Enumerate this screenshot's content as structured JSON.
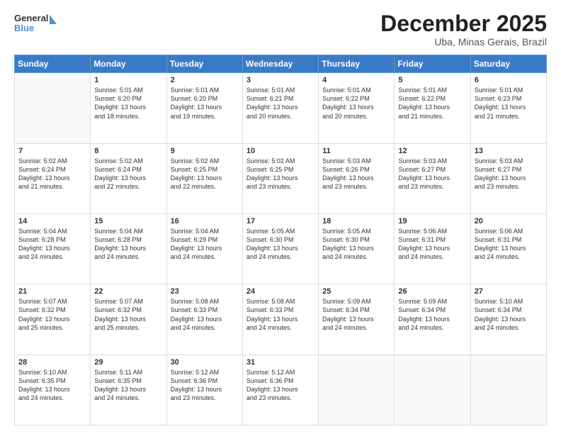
{
  "logo": {
    "line1": "General",
    "line2": "Blue"
  },
  "title": "December 2025",
  "subtitle": "Uba, Minas Gerais, Brazil",
  "days_of_week": [
    "Sunday",
    "Monday",
    "Tuesday",
    "Wednesday",
    "Thursday",
    "Friday",
    "Saturday"
  ],
  "weeks": [
    [
      {
        "day": "",
        "info": ""
      },
      {
        "day": "1",
        "info": "Sunrise: 5:01 AM\nSunset: 6:20 PM\nDaylight: 13 hours\nand 18 minutes."
      },
      {
        "day": "2",
        "info": "Sunrise: 5:01 AM\nSunset: 6:20 PM\nDaylight: 13 hours\nand 19 minutes."
      },
      {
        "day": "3",
        "info": "Sunrise: 5:01 AM\nSunset: 6:21 PM\nDaylight: 13 hours\nand 20 minutes."
      },
      {
        "day": "4",
        "info": "Sunrise: 5:01 AM\nSunset: 6:22 PM\nDaylight: 13 hours\nand 20 minutes."
      },
      {
        "day": "5",
        "info": "Sunrise: 5:01 AM\nSunset: 6:22 PM\nDaylight: 13 hours\nand 21 minutes."
      },
      {
        "day": "6",
        "info": "Sunrise: 5:01 AM\nSunset: 6:23 PM\nDaylight: 13 hours\nand 21 minutes."
      }
    ],
    [
      {
        "day": "7",
        "info": "Sunrise: 5:02 AM\nSunset: 6:24 PM\nDaylight: 13 hours\nand 21 minutes."
      },
      {
        "day": "8",
        "info": "Sunrise: 5:02 AM\nSunset: 6:24 PM\nDaylight: 13 hours\nand 22 minutes."
      },
      {
        "day": "9",
        "info": "Sunrise: 5:02 AM\nSunset: 6:25 PM\nDaylight: 13 hours\nand 22 minutes."
      },
      {
        "day": "10",
        "info": "Sunrise: 5:02 AM\nSunset: 6:25 PM\nDaylight: 13 hours\nand 23 minutes."
      },
      {
        "day": "11",
        "info": "Sunrise: 5:03 AM\nSunset: 6:26 PM\nDaylight: 13 hours\nand 23 minutes."
      },
      {
        "day": "12",
        "info": "Sunrise: 5:03 AM\nSunset: 6:27 PM\nDaylight: 13 hours\nand 23 minutes."
      },
      {
        "day": "13",
        "info": "Sunrise: 5:03 AM\nSunset: 6:27 PM\nDaylight: 13 hours\nand 23 minutes."
      }
    ],
    [
      {
        "day": "14",
        "info": "Sunrise: 5:04 AM\nSunset: 6:28 PM\nDaylight: 13 hours\nand 24 minutes."
      },
      {
        "day": "15",
        "info": "Sunrise: 5:04 AM\nSunset: 6:28 PM\nDaylight: 13 hours\nand 24 minutes."
      },
      {
        "day": "16",
        "info": "Sunrise: 5:04 AM\nSunset: 6:29 PM\nDaylight: 13 hours\nand 24 minutes."
      },
      {
        "day": "17",
        "info": "Sunrise: 5:05 AM\nSunset: 6:30 PM\nDaylight: 13 hours\nand 24 minutes."
      },
      {
        "day": "18",
        "info": "Sunrise: 5:05 AM\nSunset: 6:30 PM\nDaylight: 13 hours\nand 24 minutes."
      },
      {
        "day": "19",
        "info": "Sunrise: 5:06 AM\nSunset: 6:31 PM\nDaylight: 13 hours\nand 24 minutes."
      },
      {
        "day": "20",
        "info": "Sunrise: 5:06 AM\nSunset: 6:31 PM\nDaylight: 13 hours\nand 24 minutes."
      }
    ],
    [
      {
        "day": "21",
        "info": "Sunrise: 5:07 AM\nSunset: 6:32 PM\nDaylight: 13 hours\nand 25 minutes."
      },
      {
        "day": "22",
        "info": "Sunrise: 5:07 AM\nSunset: 6:32 PM\nDaylight: 13 hours\nand 25 minutes."
      },
      {
        "day": "23",
        "info": "Sunrise: 5:08 AM\nSunset: 6:33 PM\nDaylight: 13 hours\nand 24 minutes."
      },
      {
        "day": "24",
        "info": "Sunrise: 5:08 AM\nSunset: 6:33 PM\nDaylight: 13 hours\nand 24 minutes."
      },
      {
        "day": "25",
        "info": "Sunrise: 5:09 AM\nSunset: 6:34 PM\nDaylight: 13 hours\nand 24 minutes."
      },
      {
        "day": "26",
        "info": "Sunrise: 5:09 AM\nSunset: 6:34 PM\nDaylight: 13 hours\nand 24 minutes."
      },
      {
        "day": "27",
        "info": "Sunrise: 5:10 AM\nSunset: 6:34 PM\nDaylight: 13 hours\nand 24 minutes."
      }
    ],
    [
      {
        "day": "28",
        "info": "Sunrise: 5:10 AM\nSunset: 6:35 PM\nDaylight: 13 hours\nand 24 minutes."
      },
      {
        "day": "29",
        "info": "Sunrise: 5:11 AM\nSunset: 6:35 PM\nDaylight: 13 hours\nand 24 minutes."
      },
      {
        "day": "30",
        "info": "Sunrise: 5:12 AM\nSunset: 6:36 PM\nDaylight: 13 hours\nand 23 minutes."
      },
      {
        "day": "31",
        "info": "Sunrise: 5:12 AM\nSunset: 6:36 PM\nDaylight: 13 hours\nand 23 minutes."
      },
      {
        "day": "",
        "info": ""
      },
      {
        "day": "",
        "info": ""
      },
      {
        "day": "",
        "info": ""
      }
    ]
  ]
}
